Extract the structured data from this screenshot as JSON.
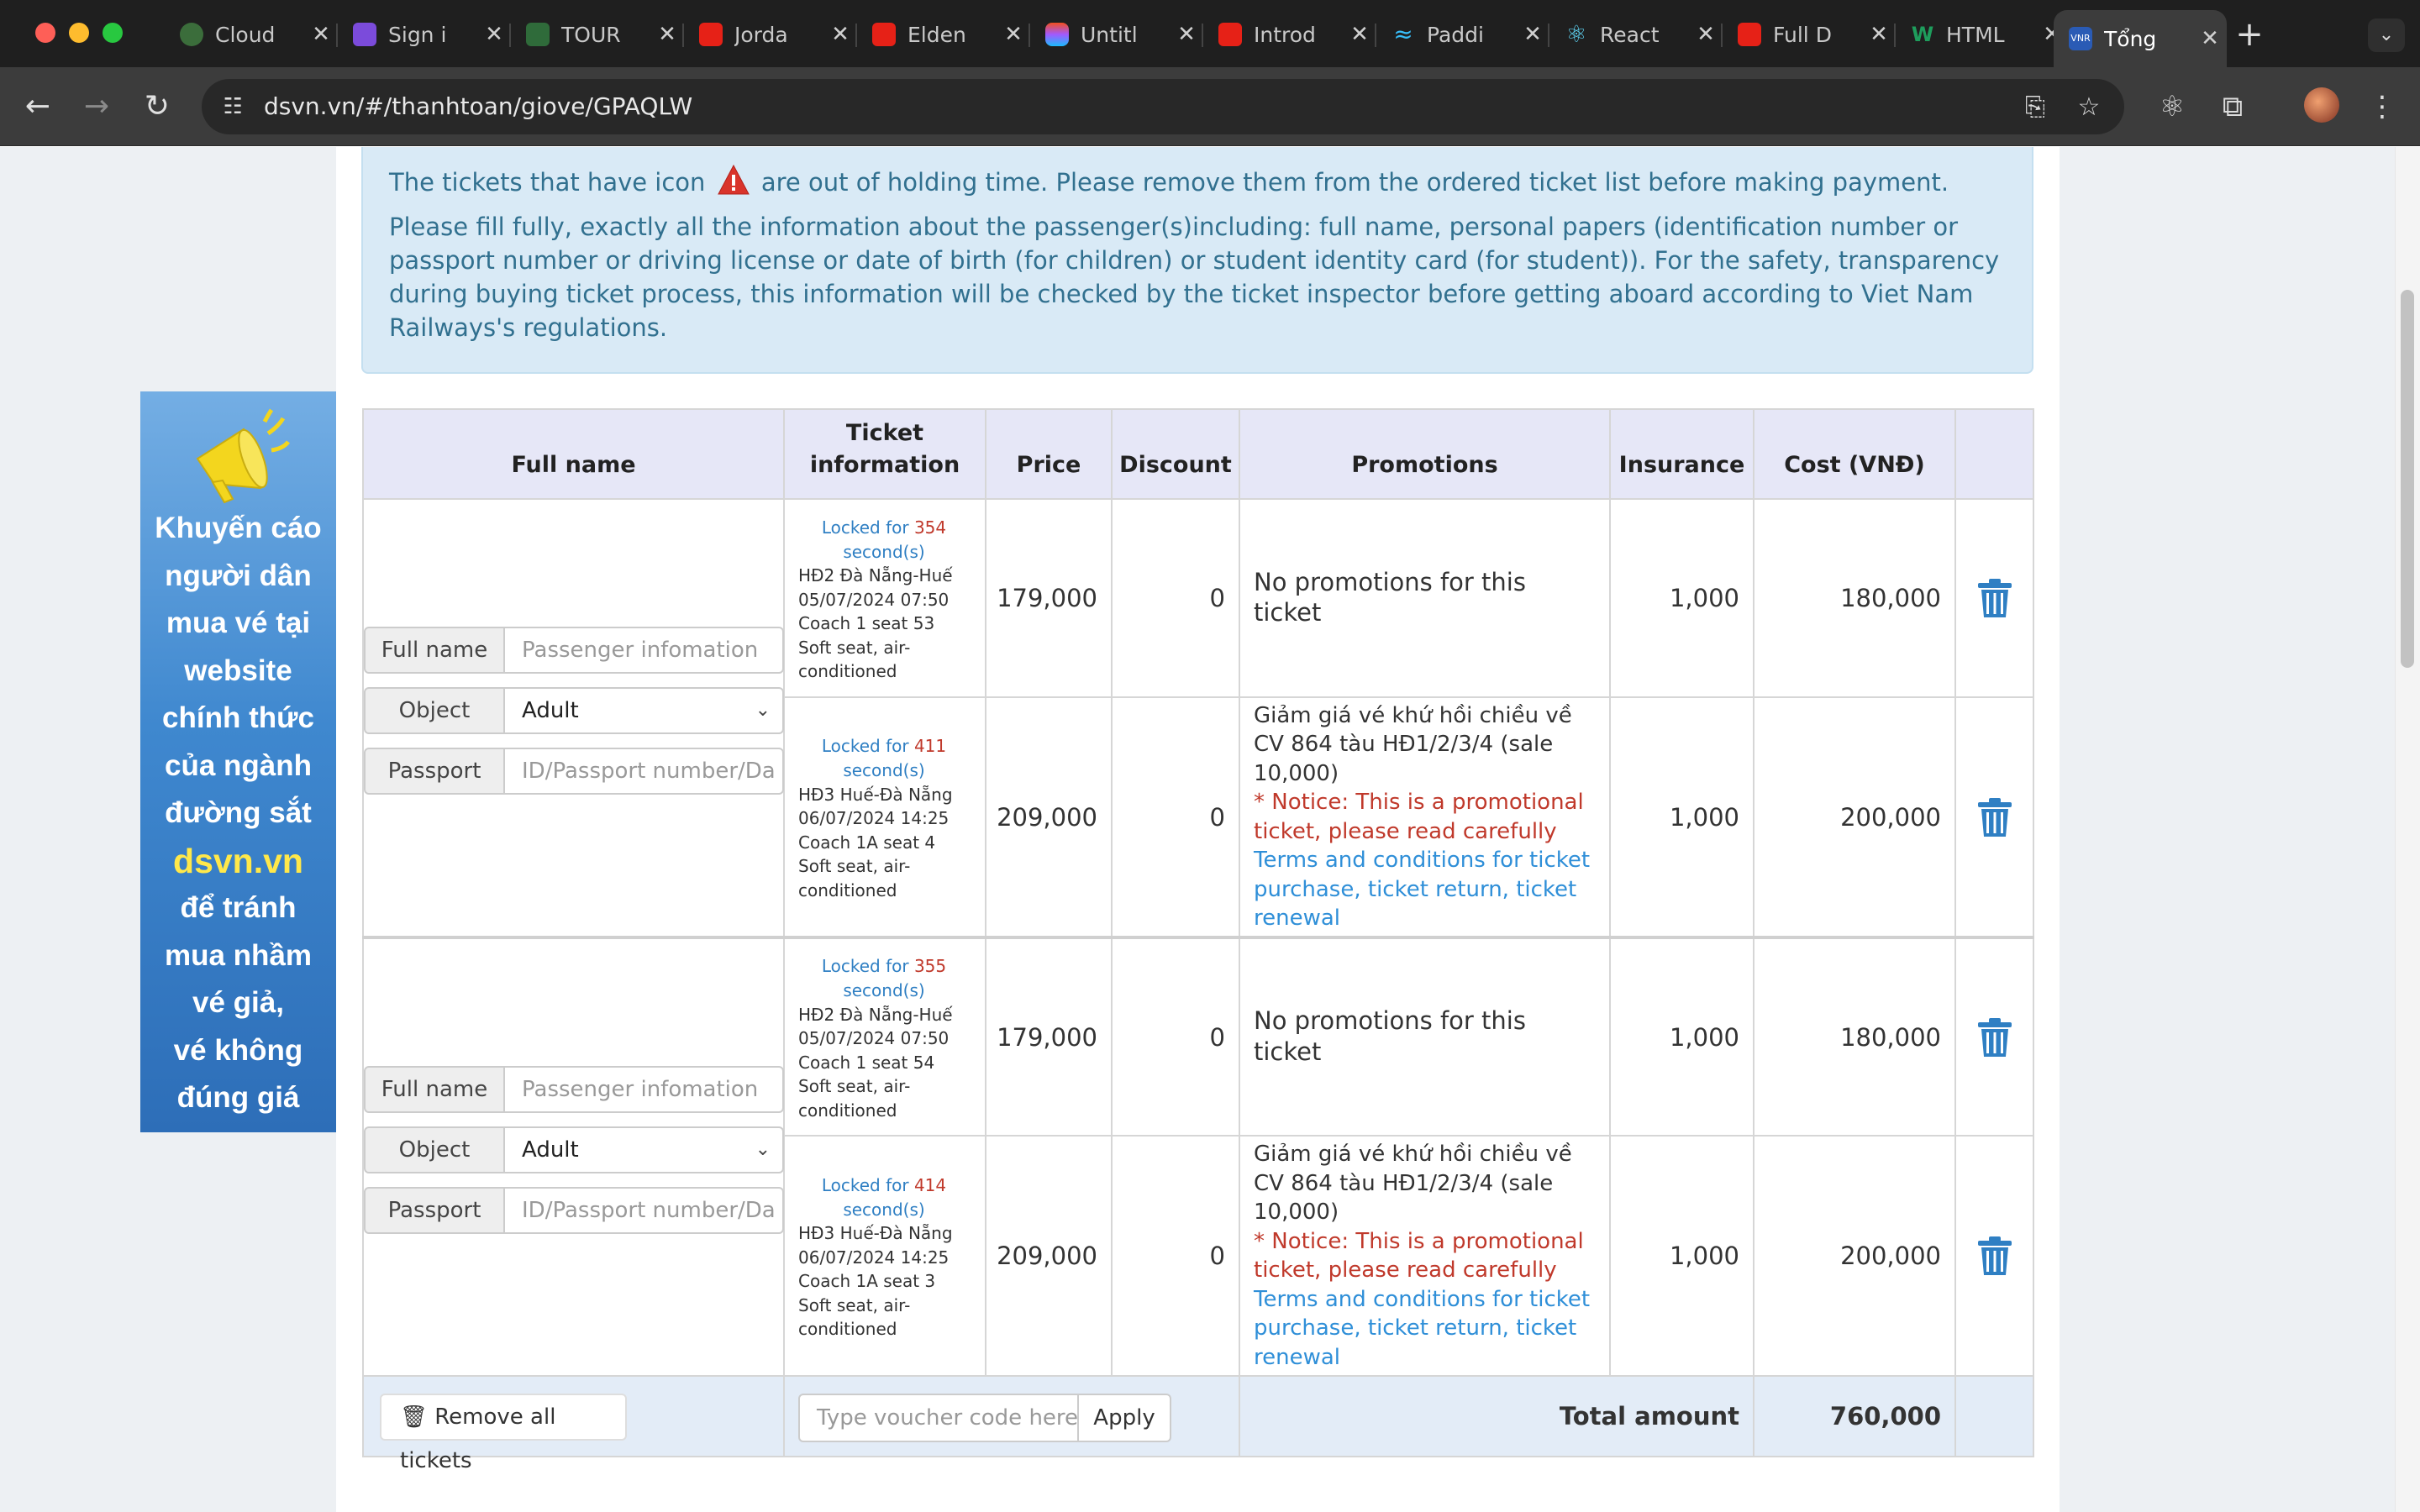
{
  "browser": {
    "tabs": [
      {
        "title": "Cloud",
        "color": "#3b6d3b"
      },
      {
        "title": "Sign i",
        "color": "#7b4bdb"
      },
      {
        "title": "TOUR",
        "color": "#2f6b3a"
      },
      {
        "title": "Jorda",
        "color": "#e62117"
      },
      {
        "title": "Elden",
        "color": "#e62117"
      },
      {
        "title": "Untitl",
        "color": "#f24e1e"
      },
      {
        "title": "Introd",
        "color": "#e62117"
      },
      {
        "title": "Paddi",
        "color": "#38bdf8"
      },
      {
        "title": "React",
        "color": "#61dafb"
      },
      {
        "title": "Full D",
        "color": "#e62117"
      },
      {
        "title": "HTML",
        "color": "#1e9d5c"
      },
      {
        "title": "Tổng",
        "color": "#2a5bb5"
      }
    ],
    "url": "dsvn.vn/#/thanhtoan/giove/GPAQLW"
  },
  "alert": {
    "line1_before": "The tickets that have icon",
    "line1_after": "are out of holding time. Please remove them from the ordered ticket list before making payment.",
    "line2": "Please fill fully, exactly all the information about the passenger(s)including: full name, personal papers (identification number or passport number or driving license or date of birth (for children) or student identity card (for student)). For the safety, transparency during buying ticket process, this information will be checked by the ticket inspector before getting aboard according to Viet Nam Railways's regulations."
  },
  "banner": {
    "lines": [
      "Khuyến cáo",
      "người dân",
      "mua vé tại",
      "website",
      "chính thức",
      "của ngành",
      "đường sắt"
    ],
    "site": "dsvn.vn",
    "lines2": [
      "để tránh",
      "mua nhầm",
      "vé giả,",
      "vé không",
      "đúng giá"
    ]
  },
  "table": {
    "headers": {
      "full_name": "Full name",
      "ticket_information": "Ticket information",
      "price": "Price",
      "discount": "Discount",
      "promotions": "Promotions",
      "insurance": "Insurance",
      "cost": "Cost (VNĐ)"
    },
    "form": {
      "full_name_label": "Full name",
      "full_name_placeholder": "Passenger infomation",
      "object_label": "Object",
      "object_value": "Adult",
      "passport_label": "Passport",
      "passport_placeholder": "ID/Passport number/Da"
    },
    "tickets": [
      {
        "locked_prefix": "Locked for",
        "seconds": "354",
        "locked_suffix": "second(s)",
        "route": "HĐ2 Đà Nẵng-Huế",
        "datetime": "05/07/2024 07:50",
        "seat": "Coach 1 seat 53",
        "seat_type": "Soft seat, air-conditioned",
        "price": "179,000",
        "discount": "0",
        "promotion": "No promotions for this ticket",
        "insurance": "1,000",
        "cost": "180,000"
      },
      {
        "locked_prefix": "Locked for",
        "seconds": "411",
        "locked_suffix": "second(s)",
        "route": "HĐ3 Huế-Đà Nẵng",
        "datetime": "06/07/2024 14:25",
        "seat": "Coach 1A seat 4",
        "seat_type": "Soft seat, air-conditioned",
        "price": "209,000",
        "discount": "0",
        "promotion": "Giảm giá vé khứ hồi chiều về CV 864 tàu HĐ1/2/3/4 (sale 10,000)",
        "notice": "* Notice: This is a promotional ticket, please read carefully",
        "terms": "Terms and conditions for ticket purchase, ticket return, ticket renewal",
        "insurance": "1,000",
        "cost": "200,000"
      },
      {
        "locked_prefix": "Locked for",
        "seconds": "355",
        "locked_suffix": "second(s)",
        "route": "HĐ2 Đà Nẵng-Huế",
        "datetime": "05/07/2024 07:50",
        "seat": "Coach 1 seat 54",
        "seat_type": "Soft seat, air-conditioned",
        "price": "179,000",
        "discount": "0",
        "promotion": "No promotions for this ticket",
        "insurance": "1,000",
        "cost": "180,000"
      },
      {
        "locked_prefix": "Locked for",
        "seconds": "414",
        "locked_suffix": "second(s)",
        "route": "HĐ3 Huế-Đà Nẵng",
        "datetime": "06/07/2024 14:25",
        "seat": "Coach 1A seat 3",
        "seat_type": "Soft seat, air-conditioned",
        "price": "209,000",
        "discount": "0",
        "promotion": "Giảm giá vé khứ hồi chiều về CV 864 tàu HĐ1/2/3/4 (sale 10,000)",
        "notice": "* Notice: This is a promotional ticket, please read carefully",
        "terms": "Terms and conditions for ticket purchase, ticket return, ticket renewal",
        "insurance": "1,000",
        "cost": "200,000"
      }
    ],
    "footer": {
      "remove_all": "Remove all tickets",
      "voucher_placeholder": "Type voucher code here",
      "apply": "Apply",
      "total_label": "Total amount",
      "total_value": "760,000"
    }
  }
}
